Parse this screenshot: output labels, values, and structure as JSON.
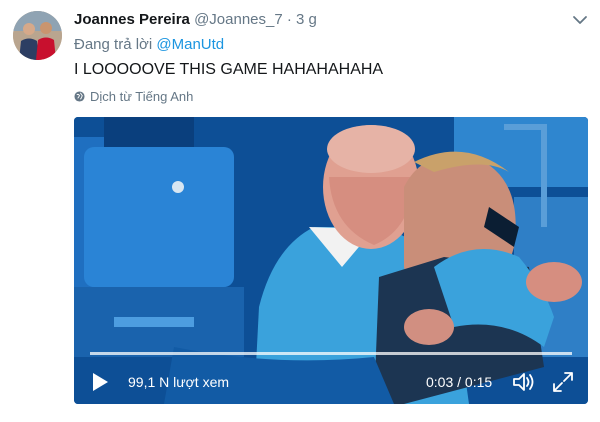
{
  "tweet": {
    "author_name": "Joannes Pereira",
    "author_handle": "@Joannes_7",
    "separator": "·",
    "time": "3 g",
    "reply_prefix": "Đang trả lời",
    "reply_mention": "@ManUtd",
    "text": "I LOOOOOVE THIS GAME HAHAHAHAHA",
    "translate_label": "Dịch từ Tiếng Anh"
  },
  "video": {
    "views": "99,1 N lượt xem",
    "duration": "0:03 / 0:15",
    "progress": 0.2
  },
  "icons": {
    "caret": "chevron-down-icon",
    "translate": "globe-icon",
    "play": "play-icon",
    "volume": "volume-icon",
    "fullscreen": "fullscreen-icon"
  },
  "colors": {
    "link": "#1b95e0",
    "secondary_text": "#657786",
    "primary_text": "#14171a"
  }
}
